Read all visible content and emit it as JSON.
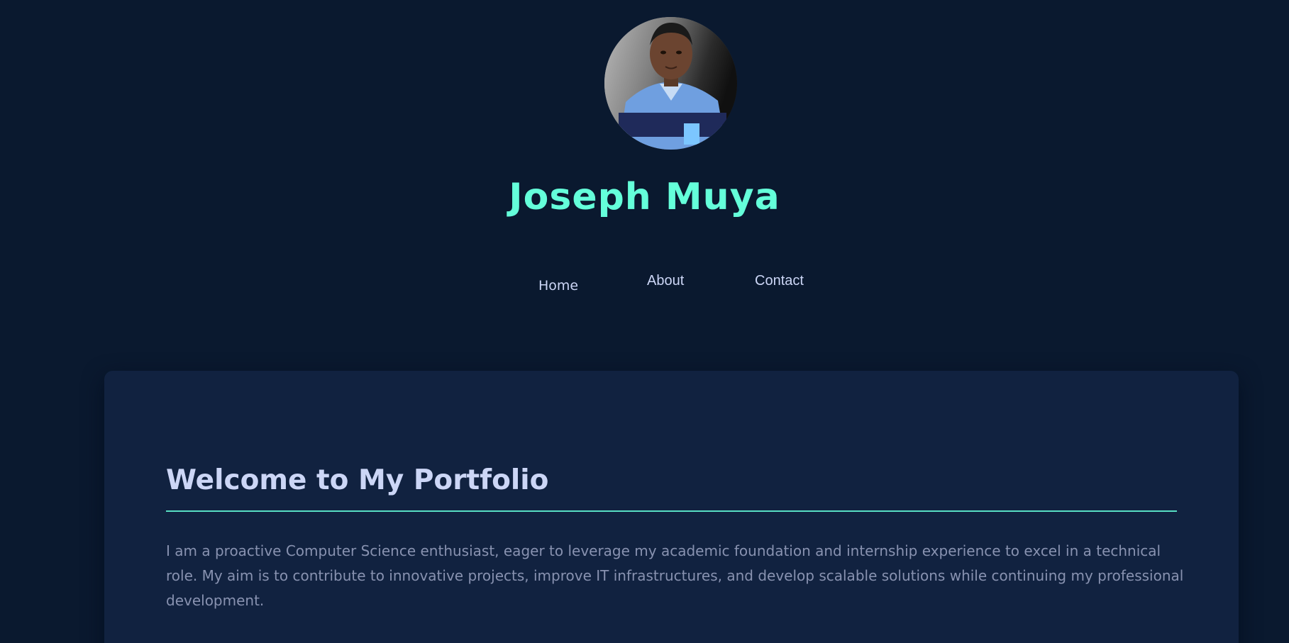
{
  "header": {
    "name": "Joseph Muya",
    "avatar_icon": "profile-photo"
  },
  "nav": {
    "items": [
      {
        "label": "Home"
      },
      {
        "label": "About"
      },
      {
        "label": "Contact"
      }
    ]
  },
  "main": {
    "heading": "Welcome to My Portfolio",
    "intro": "I am a proactive Computer Science enthusiast, eager to leverage my academic foundation and internship experience to excel in a technical role. My aim is to contribute to innovative projects, improve IT infrastructures, and develop scalable solutions while continuing my professional development."
  },
  "colors": {
    "background": "#0a192f",
    "card": "#112240",
    "accent": "#64ffda",
    "heading_text": "#ccd6f6",
    "body_text": "#8892b0"
  }
}
